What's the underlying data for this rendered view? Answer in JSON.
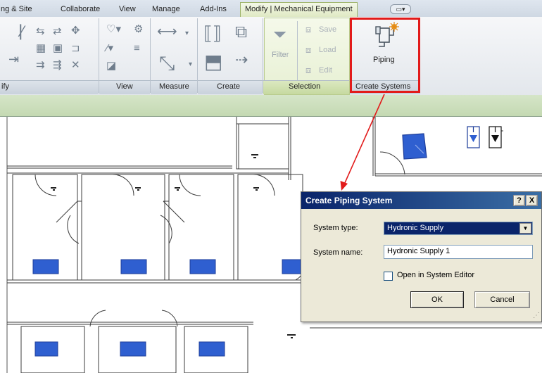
{
  "tabs": [
    {
      "label": "ng & Site"
    },
    {
      "label": "Collaborate"
    },
    {
      "label": "View"
    },
    {
      "label": "Manage"
    },
    {
      "label": "Add-Ins"
    },
    {
      "label": "Modify | Mechanical Equipment",
      "active": true
    }
  ],
  "ribbon": {
    "panels": {
      "modify": "ify",
      "view": "View",
      "measure": "Measure",
      "create": "Create",
      "selection": "Selection",
      "create_systems": "Create Systems"
    },
    "selection": {
      "filter": "Filter",
      "save": "Save",
      "load": "Load",
      "edit": "Edit"
    },
    "piping_button": "Piping"
  },
  "dialog": {
    "title": "Create Piping System",
    "help": "?",
    "close": "X",
    "system_type_label": "System type:",
    "system_type_value": "Hydronic Supply",
    "system_name_label": "System name:",
    "system_name_value": "Hydronic Supply 1",
    "open_editor_label": "Open in System Editor",
    "open_editor_checked": false,
    "ok": "OK",
    "cancel": "Cancel"
  },
  "colors": {
    "highlight_box": "#e21a1a",
    "arrow": "#e21a1a",
    "equipment": "#2f5fd0",
    "title_bar": "#0a246a",
    "modify_tab": "#dfe9c3",
    "options_bar": "#c9dcb8"
  }
}
